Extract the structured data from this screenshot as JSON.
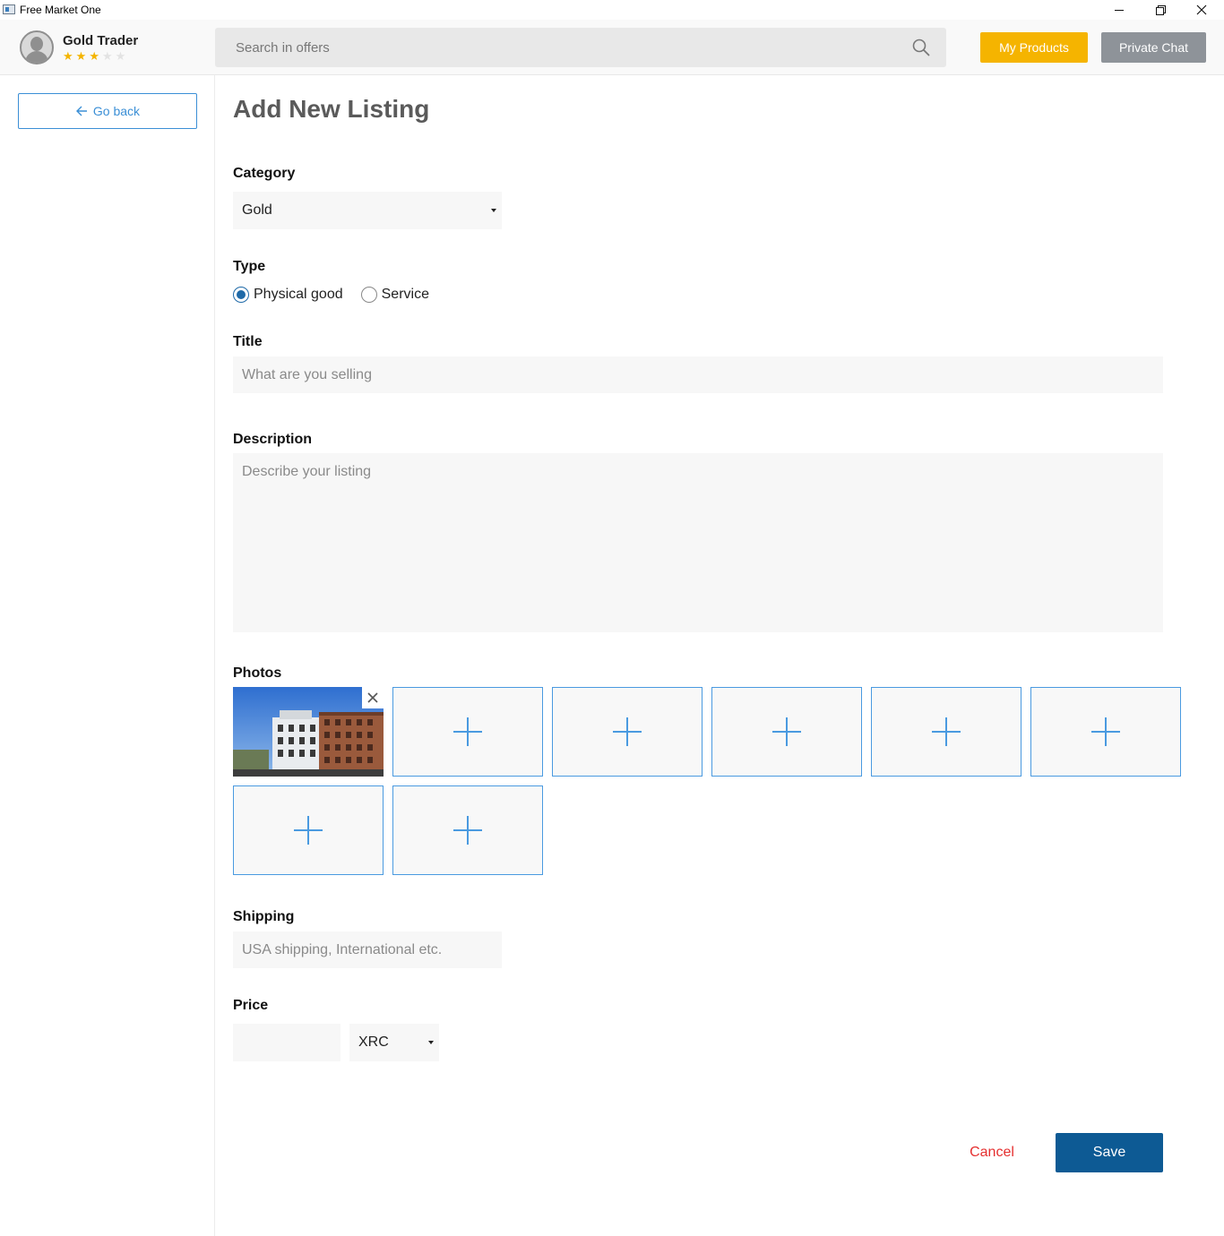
{
  "window": {
    "title": "Free Market One"
  },
  "header": {
    "user_name": "Gold Trader",
    "rating": 3,
    "rating_max": 5,
    "search_placeholder": "Search in offers",
    "my_products_label": "My Products",
    "private_chat_label": "Private Chat",
    "colors": {
      "my_products": "#f5b400",
      "private_chat": "#8e9399",
      "star": "#f4b400"
    }
  },
  "sidebar": {
    "go_back_label": "Go back"
  },
  "form": {
    "title": "Add New Listing",
    "category_label": "Category",
    "category_value": "Gold",
    "type_label": "Type",
    "type_options": [
      {
        "label": "Physical good",
        "checked": true
      },
      {
        "label": "Service",
        "checked": false
      }
    ],
    "title_label": "Title",
    "title_placeholder": "What are you selling",
    "description_label": "Description",
    "description_placeholder": "Describe your listing",
    "photos_label": "Photos",
    "photos": {
      "filled": 1,
      "empty_slots": 7
    },
    "shipping_label": "Shipping",
    "shipping_placeholder": "USA shipping, International etc.",
    "price_label": "Price",
    "price_value": "",
    "currency_value": "XRC",
    "cancel_label": "Cancel",
    "save_label": "Save",
    "colors": {
      "save": "#0d5a94",
      "cancel": "#e52f2f",
      "accent": "#4a9ae0"
    }
  }
}
